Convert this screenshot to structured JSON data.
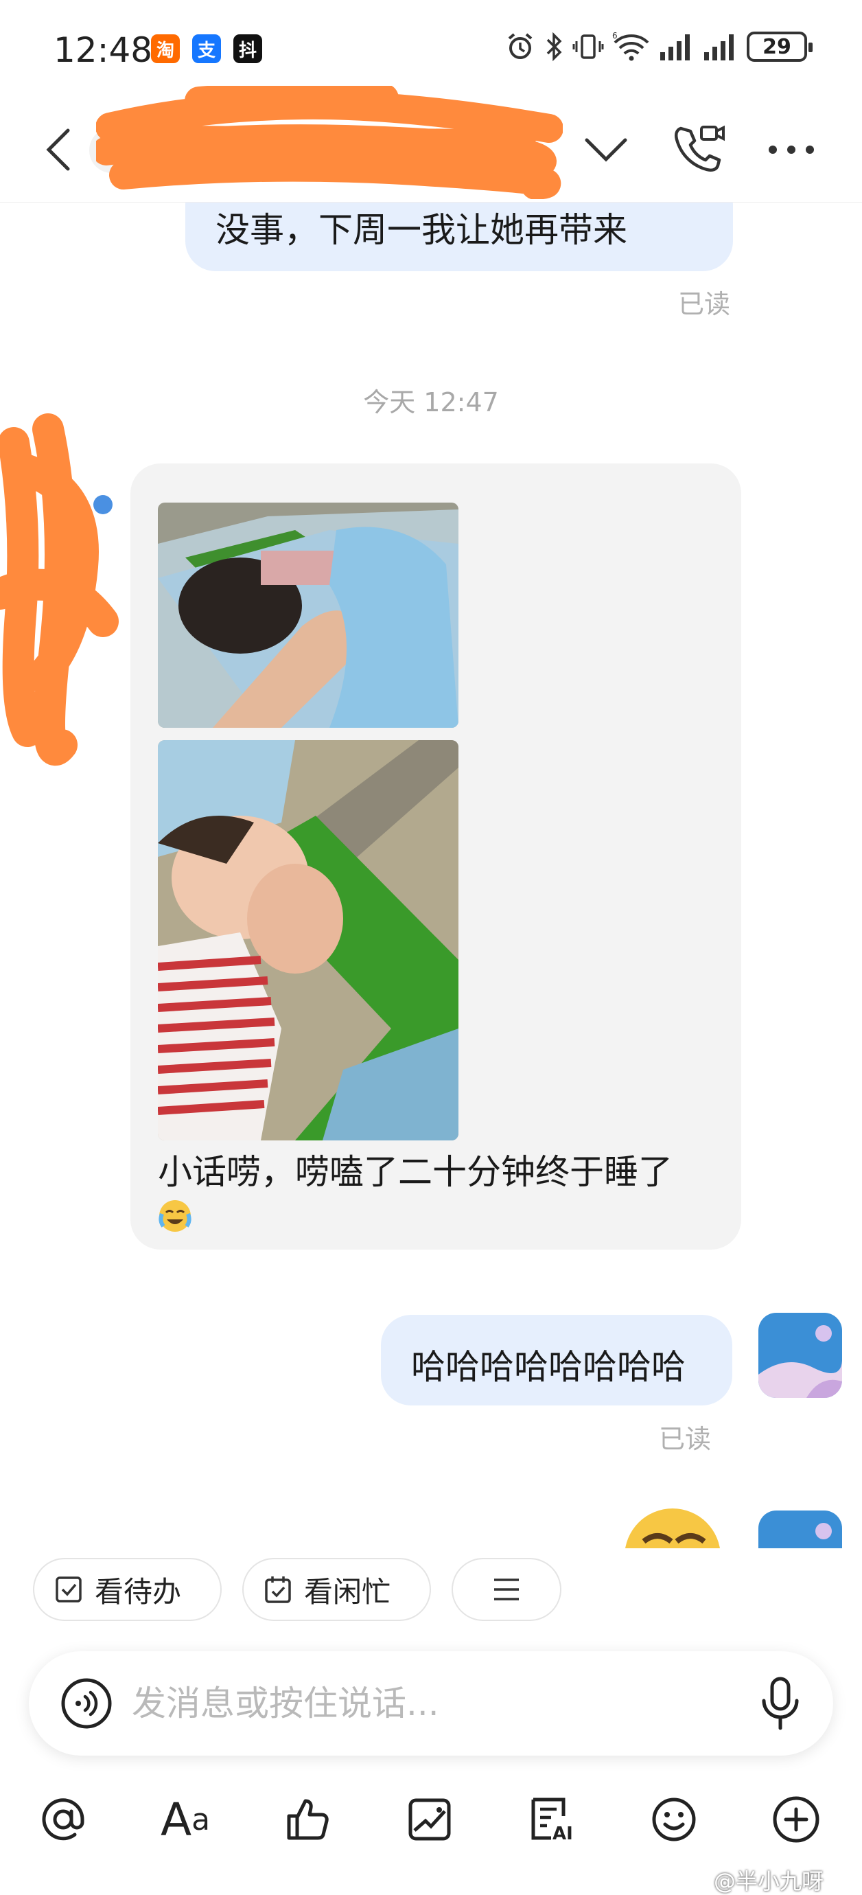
{
  "status_bar": {
    "time": "12:48",
    "apps": [
      "淘",
      "支",
      "抖"
    ],
    "battery": "29"
  },
  "header": {
    "contact_name": ""
  },
  "messages": {
    "outgoing_top": "没事，下周一我让她再带来",
    "read_1": "已读",
    "timestamp": "今天 12:47",
    "incoming_text": "小话唠，唠嗑了二十分钟终于睡了",
    "outgoing_2": "哈哈哈哈哈哈哈哈",
    "read_2": "已读"
  },
  "quick_actions": {
    "todo": "看待办",
    "busy": "看闲忙"
  },
  "input": {
    "placeholder": "发消息或按住说话..."
  },
  "toolbar": {
    "text_format_a": "A",
    "text_format_a_small": "a"
  },
  "watermark": "@半小九呀",
  "colors": {
    "out_bubble": "#e6effd",
    "in_bubble": "#f3f3f3",
    "scribble": "#ff8a3d",
    "read_text": "#b0b0b0"
  }
}
